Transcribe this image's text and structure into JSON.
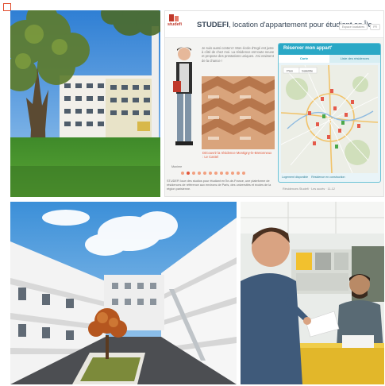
{
  "website": {
    "logo_text": "studefi",
    "title_prefix": "STUDEFI",
    "title_rest": ", location d'appartement pour étudiant en Île",
    "speech_text": "Je suis aussi content ! Mon école d'Ingé est juste à côté de chez moi. La résidence est toute neuve et propose des prestations uniques. J'ai vraiment de la chance !",
    "quote_line": "Découvrir la résidence Montigny-le-Bretonneux : Le Castel",
    "caption_name": "Maxime",
    "intro_text": "STUDEFI loue des studios pour étudiant en Île-de-France, une plateforme de résidences de référence aux environs de Paris, des universités et écoles de la région parisienne.",
    "login_text": "Résidences Studefi · Les accès · 11-12",
    "panel": {
      "title": "Réserver mon appart'",
      "tabs": [
        {
          "label": "Carte",
          "active": true
        },
        {
          "label": "Liste des résidences",
          "active": false
        }
      ],
      "map_controls": [
        "Plan",
        "Satellite"
      ],
      "legend_left": "Logement disponible",
      "legend_right": "Résidence en construction"
    },
    "top_buttons": [
      "Espace locataires",
      "FR"
    ]
  },
  "colors": {
    "accent_orange": "#e2573a",
    "panel_blue": "#2aa8c6",
    "sky_blue": "#3b8fd8",
    "grass_green": "#3f8a2a"
  }
}
